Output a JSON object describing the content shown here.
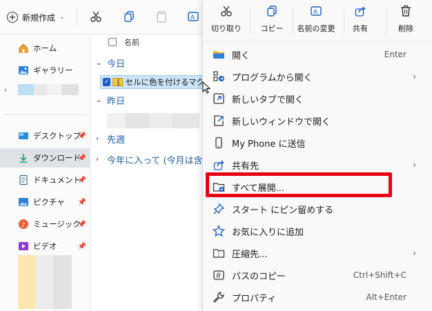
{
  "toolbar": {
    "new_label": "新規作成"
  },
  "nav": {
    "items": [
      {
        "label": "ホーム",
        "icon": "home-icon"
      },
      {
        "label": "ギャラリー",
        "icon": "gallery-icon"
      },
      {
        "label": "デスクトップ",
        "icon": "desktop-icon",
        "pinned": true
      },
      {
        "label": "ダウンロード",
        "icon": "download-icon",
        "pinned": true
      },
      {
        "label": "ドキュメント",
        "icon": "document-icon",
        "pinned": true
      },
      {
        "label": "ピクチャ",
        "icon": "picture-icon",
        "pinned": true
      },
      {
        "label": "ミュージック",
        "icon": "music-icon",
        "pinned": true
      },
      {
        "label": "ビデオ",
        "icon": "video-icon",
        "pinned": true
      }
    ]
  },
  "list": {
    "header_name": "名前",
    "groups": [
      {
        "label": "今日",
        "expanded": true
      },
      {
        "label": "昨日",
        "expanded": true
      },
      {
        "label": "先週",
        "expanded": false
      },
      {
        "label": "今年に入って (今月は含",
        "expanded": false
      }
    ],
    "selected_file": "セルに色を付けるマクロ"
  },
  "menu": {
    "commands": [
      {
        "label": "切り取り",
        "icon": "scissors-icon"
      },
      {
        "label": "コピー",
        "icon": "copy-icon"
      },
      {
        "label": "名前の変更",
        "icon": "rename-icon"
      },
      {
        "label": "共有",
        "icon": "share-icon"
      },
      {
        "label": "削除",
        "icon": "trash-icon"
      }
    ],
    "items": [
      {
        "label": "開く",
        "shortcut": "Enter",
        "icon": "folder-open-icon"
      },
      {
        "label": "プログラムから開く",
        "shortcut": "",
        "submenu": true,
        "icon": "open-with-icon"
      },
      {
        "label": "新しいタブで開く",
        "shortcut": "",
        "icon": "new-tab-icon"
      },
      {
        "label": "新しいウィンドウで開く",
        "shortcut": "",
        "icon": "new-window-icon"
      },
      {
        "label": "My Phone に送信",
        "shortcut": "",
        "icon": "phone-icon"
      },
      {
        "label": "共有先",
        "shortcut": "",
        "submenu": true,
        "icon": "share-to-icon"
      },
      {
        "label": "すべて展開...",
        "shortcut": "",
        "icon": "extract-icon"
      },
      {
        "label": "スタート にピン留めする",
        "shortcut": "",
        "icon": "pin-icon"
      },
      {
        "label": "お気に入りに追加",
        "shortcut": "",
        "icon": "star-icon"
      },
      {
        "label": "圧縮先...",
        "shortcut": "",
        "submenu": true,
        "icon": "compress-icon"
      },
      {
        "label": "パスのコピー",
        "shortcut": "Ctrl+Shift+C",
        "icon": "copy-path-icon"
      },
      {
        "label": "プロパティ",
        "shortcut": "Alt+Enter",
        "icon": "properties-icon"
      }
    ]
  },
  "colors": {
    "highlight": "#e60012",
    "accent": "#1a5ec2"
  }
}
